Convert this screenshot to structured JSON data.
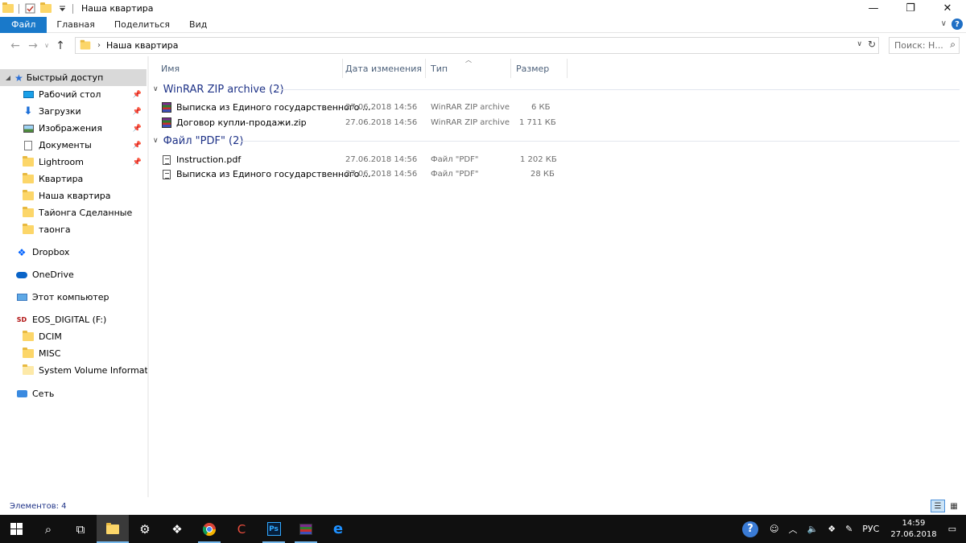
{
  "window": {
    "title": "Наша квартира",
    "minimize": "—",
    "maximize": "❐",
    "close": "✕"
  },
  "ribbon": {
    "tabs": [
      "Файл",
      "Главная",
      "Поделиться",
      "Вид"
    ],
    "expand": "∨",
    "help": "?"
  },
  "address": {
    "path": "Наша квартира",
    "search_placeholder": "Поиск: Н..."
  },
  "sidebar": {
    "quick_access": "Быстрый доступ",
    "items": [
      {
        "label": "Рабочий стол",
        "pinned": true
      },
      {
        "label": "Загрузки",
        "pinned": true
      },
      {
        "label": "Изображения",
        "pinned": true
      },
      {
        "label": "Документы",
        "pinned": true
      },
      {
        "label": "Lightroom",
        "pinned": true
      },
      {
        "label": "Квартира",
        "pinned": false
      },
      {
        "label": "Наша квартира",
        "pinned": false
      },
      {
        "label": "Тайонга Сделанные",
        "pinned": false
      },
      {
        "label": "таонга",
        "pinned": false
      }
    ],
    "dropbox": "Dropbox",
    "onedrive": "OneDrive",
    "this_pc": "Этот компьютер",
    "drive": "EOS_DIGITAL (F:)",
    "drive_items": [
      "DCIM",
      "MISC",
      "System Volume Information"
    ],
    "network": "Сеть"
  },
  "columns": {
    "name": "Имя",
    "date": "Дата изменения",
    "type": "Тип",
    "size": "Размер"
  },
  "groups": [
    {
      "title": "WinRAR ZIP archive (2)",
      "files": [
        {
          "name": "Выписка из Единого государственного ...",
          "date": "27.06.2018 14:56",
          "type": "WinRAR ZIP archive",
          "size": "6 КБ"
        },
        {
          "name": "Договор купли-продажи.zip",
          "date": "27.06.2018 14:56",
          "type": "WinRAR ZIP archive",
          "size": "1 711 КБ"
        }
      ]
    },
    {
      "title": "Файл \"PDF\" (2)",
      "files": [
        {
          "name": "Instruction.pdf",
          "date": "27.06.2018 14:56",
          "type": "Файл \"PDF\"",
          "size": "1 202 КБ"
        },
        {
          "name": "Выписка из Единого государственного ...",
          "date": "27.06.2018 14:56",
          "type": "Файл \"PDF\"",
          "size": "28 КБ"
        }
      ]
    }
  ],
  "status": {
    "count": "Элементов: 4"
  },
  "taskbar": {
    "lang": "РУС",
    "time": "14:59",
    "date": "27.06.2018"
  }
}
